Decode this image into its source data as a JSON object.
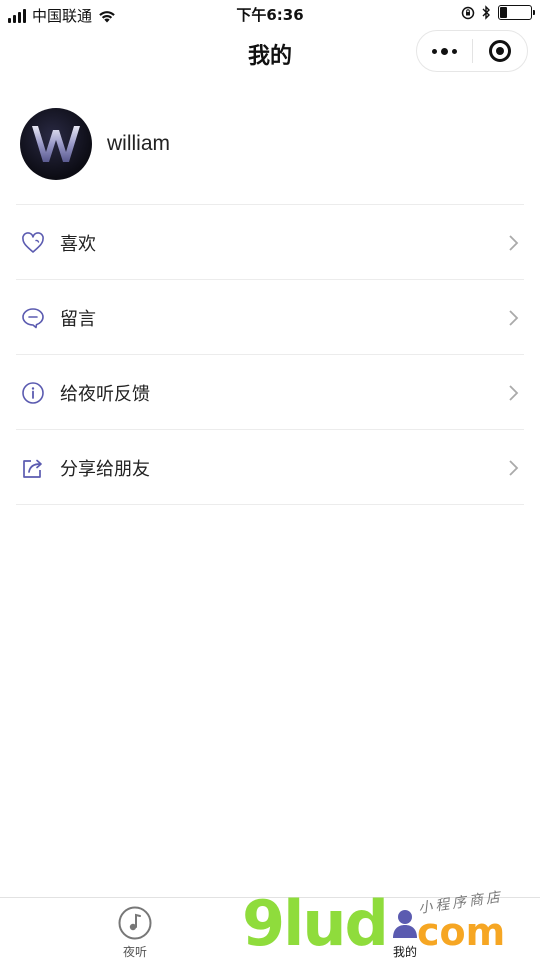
{
  "status_bar": {
    "carrier": "中国联通",
    "time": "下午6:36"
  },
  "nav": {
    "title": "我的",
    "menu_icon": "more-dots-icon",
    "close_icon": "target-circle-icon"
  },
  "profile": {
    "username": "william",
    "avatar_icon": "avatar-letter-w"
  },
  "menu": {
    "items": [
      {
        "label": "喜欢",
        "icon": "heart-icon"
      },
      {
        "label": "留言",
        "icon": "message-bubble-icon"
      },
      {
        "label": "给夜听反馈",
        "icon": "info-icon"
      },
      {
        "label": "分享给朋友",
        "icon": "share-icon"
      }
    ]
  },
  "tabbar": {
    "tabs": [
      {
        "label": "夜听",
        "icon": "music-disc-icon",
        "active": false
      },
      {
        "label": "我的",
        "icon": "person-icon",
        "active": true
      }
    ]
  },
  "watermark": {
    "brand": "9lud",
    "domain": "com",
    "slogan": "小程序商店"
  },
  "colors": {
    "accent": "#5b5bb0",
    "watermark_green": "#8fdc3c",
    "watermark_orange": "#f6a623"
  }
}
